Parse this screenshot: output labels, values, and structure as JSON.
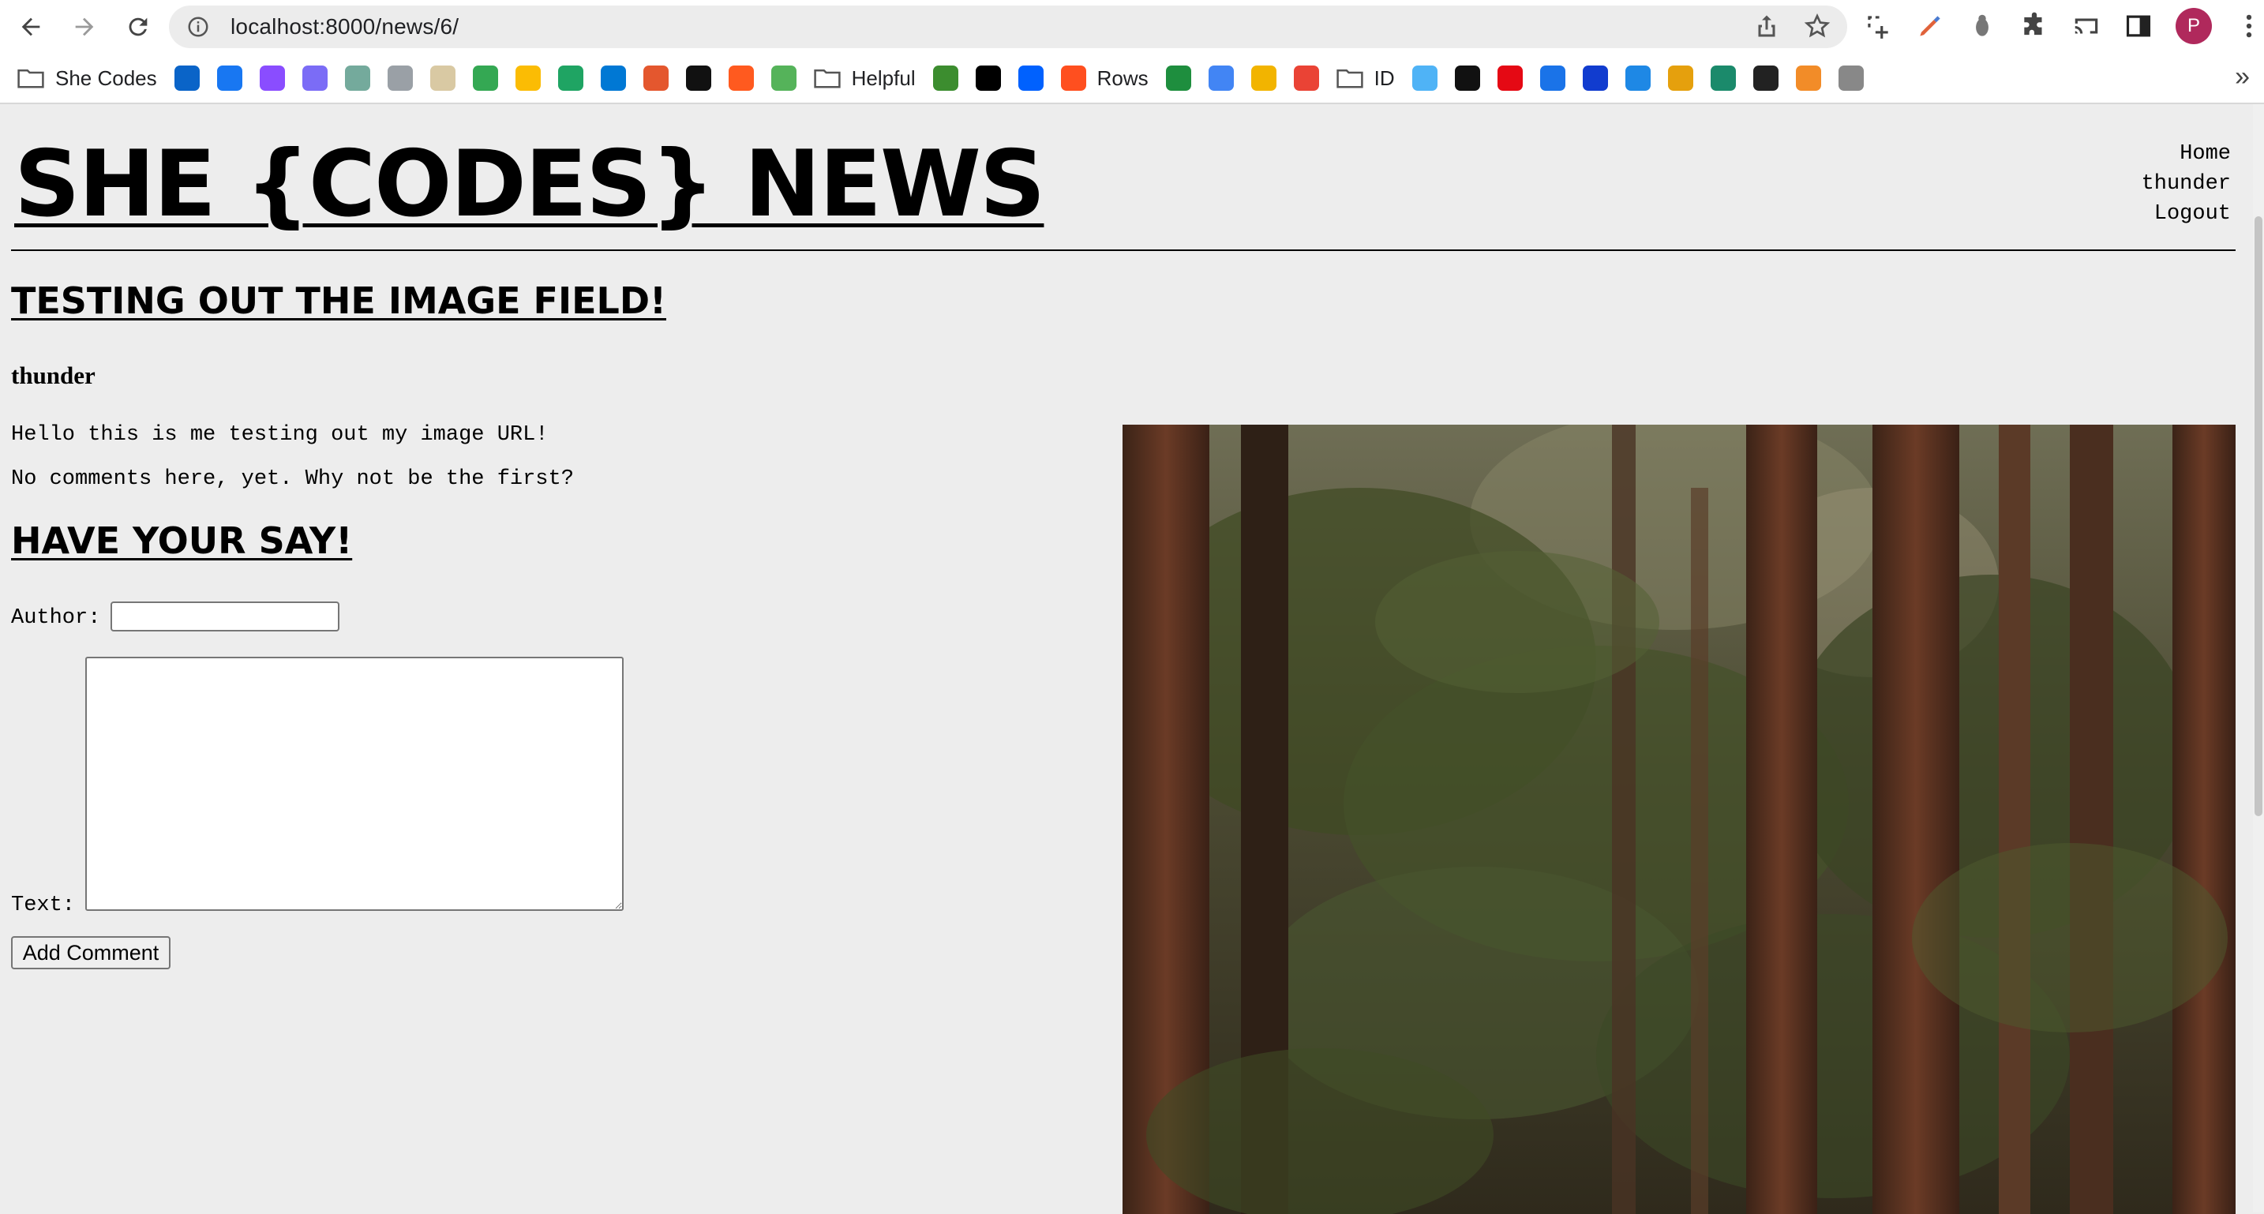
{
  "browser": {
    "url": "localhost:8000/news/6/",
    "profile_initial": "P",
    "bookmarks": [
      {
        "label": "She Codes",
        "icon": "folder-icon"
      },
      {
        "label": "",
        "icon": "outlook-icon",
        "color": "#0a64c8"
      },
      {
        "label": "",
        "icon": "facebook-icon",
        "color": "#1877f2"
      },
      {
        "label": "",
        "icon": "messenger-icon",
        "color": "#8a4dff"
      },
      {
        "label": "",
        "icon": "sparkle-icon",
        "color": "#7b6cf6"
      },
      {
        "label": "",
        "icon": "chatgpt-icon",
        "color": "#74aa9c"
      },
      {
        "label": "",
        "icon": "disc-icon",
        "color": "#9aa0a6"
      },
      {
        "label": "",
        "icon": "goodreads-icon",
        "color": "#d9c9a3"
      },
      {
        "label": "",
        "icon": "maps-pin-icon",
        "color": "#34a853"
      },
      {
        "label": "",
        "icon": "photos-icon",
        "color": "#fbbc04"
      },
      {
        "label": "",
        "icon": "drive-icon",
        "color": "#1fa463"
      },
      {
        "label": "",
        "icon": "onedrive-icon",
        "color": "#0078d4"
      },
      {
        "label": "",
        "icon": "animal-icon",
        "color": "#e4572e"
      },
      {
        "label": "",
        "icon": "u-logo-icon",
        "color": "#111111"
      },
      {
        "label": "",
        "icon": "arrow-logo-icon",
        "color": "#ff5a1f"
      },
      {
        "label": "",
        "icon": "leaf-icon",
        "color": "#55b35a"
      },
      {
        "label": "Helpful",
        "icon": "folder-icon"
      },
      {
        "label": "",
        "icon": "infinity-icon",
        "color": "#3c8d2f"
      },
      {
        "label": "",
        "icon": "notion-icon",
        "color": "#000000"
      },
      {
        "label": "",
        "icon": "dropbox-icon",
        "color": "#0061fe"
      },
      {
        "label": "Rows",
        "icon": "rows-icon",
        "color": "#ff4f1f"
      },
      {
        "label": "",
        "icon": "sheets-icon",
        "color": "#1e8e3e"
      },
      {
        "label": "",
        "icon": "docs-icon",
        "color": "#4285f4"
      },
      {
        "label": "",
        "icon": "triangle-icon",
        "color": "#f2b400"
      },
      {
        "label": "",
        "icon": "gmail-icon",
        "color": "#ea4335"
      },
      {
        "label": "ID",
        "icon": "folder-icon"
      },
      {
        "label": "",
        "icon": "ring-icon",
        "color": "#4fb3f6"
      },
      {
        "label": "",
        "icon": "a-logo-icon",
        "color": "#111111"
      },
      {
        "label": "",
        "icon": "netflix-icon",
        "color": "#e50914"
      },
      {
        "label": "",
        "icon": "play-icon",
        "color": "#1a73e8"
      },
      {
        "label": "",
        "icon": "disney-icon",
        "color": "#113ccf"
      },
      {
        "label": "",
        "icon": "s-logo-icon",
        "color": "#1e88e5"
      },
      {
        "label": "",
        "icon": "plex-icon",
        "color": "#e5a00d"
      },
      {
        "label": "",
        "icon": "c-logo-icon",
        "color": "#1b8a6b"
      },
      {
        "label": "",
        "icon": "stripes-icon",
        "color": "#222222"
      },
      {
        "label": "",
        "icon": "orange-logo-icon",
        "color": "#f28c28"
      },
      {
        "label": "",
        "icon": "apple-icon",
        "color": "#888888"
      }
    ],
    "bookmarks_more": "»"
  },
  "site": {
    "title": "SHE {CODES} NEWS",
    "nav": [
      "Home",
      "thunder",
      "Logout"
    ]
  },
  "story": {
    "title": "TESTING OUT THE IMAGE FIELD!",
    "author": "thunder",
    "content": "Hello this is me testing out my image URL!",
    "comments_empty": "No comments here, yet. Why not be the first?"
  },
  "comment_form": {
    "heading": "HAVE YOUR SAY!",
    "author_label": "Author:",
    "author_value": "",
    "text_label": "Text:",
    "submit_label": "Add Comment"
  },
  "colors": {
    "page_bg": "#ededed",
    "avatar": "#b0295c"
  }
}
